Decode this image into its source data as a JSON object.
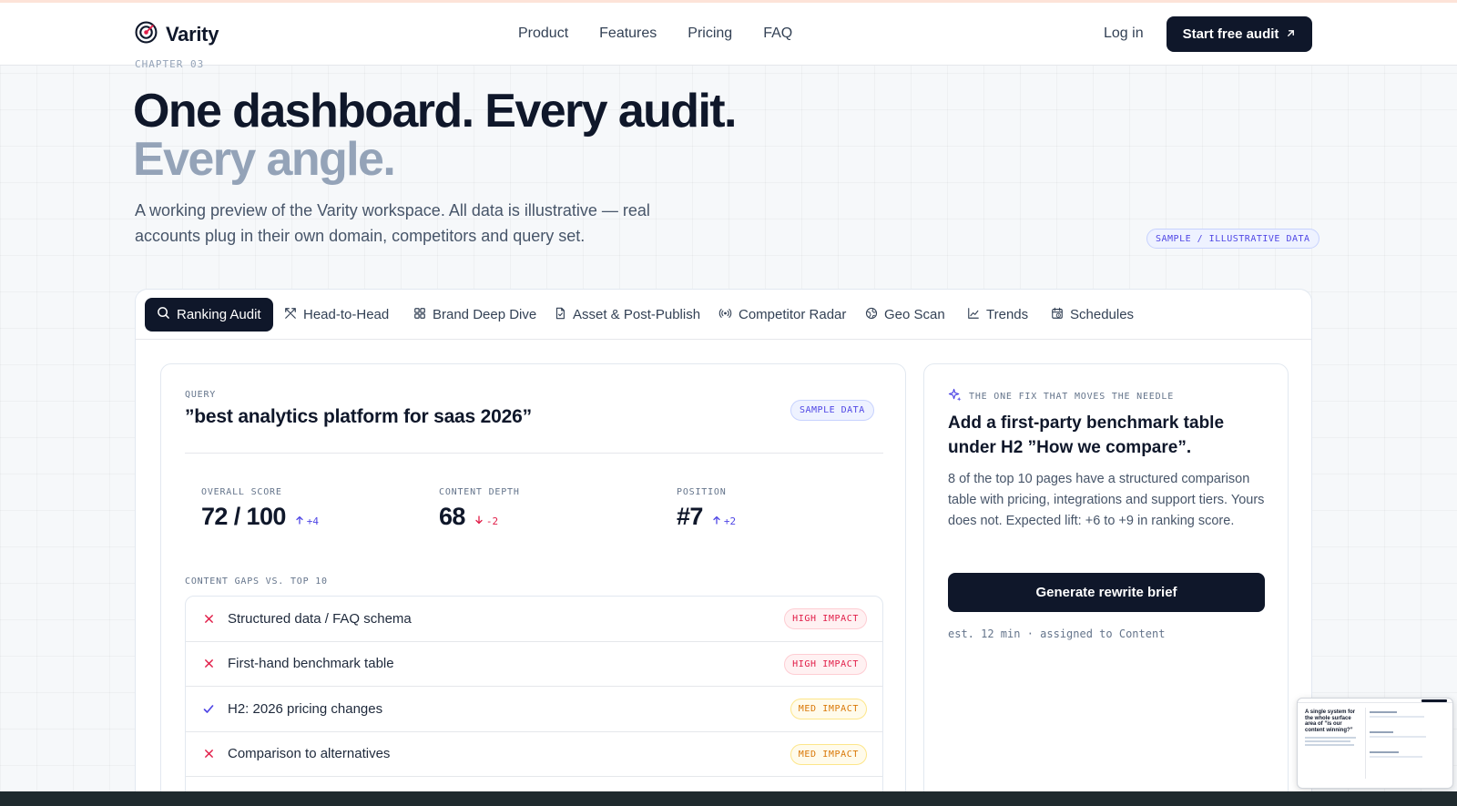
{
  "header": {
    "logo_text": "Varity",
    "nav": [
      "Product",
      "Features",
      "Pricing",
      "FAQ"
    ],
    "login": "Log in",
    "cta_label": "Start free audit",
    "cta_icon": "arrow-up-right-icon"
  },
  "hero": {
    "chapter": "CHAPTER 03",
    "title_line1": "One dashboard. Every audit.",
    "title_line2": "Every angle.",
    "lede": "A working preview of the Varity workspace. All data is illustrative — real accounts plug in their own domain, competitors and query set.",
    "sample_pill": "SAMPLE / ILLUSTRATIVE DATA"
  },
  "tabs": [
    {
      "label": "Ranking Audit",
      "icon": "search-icon",
      "active": true
    },
    {
      "label": "Head-to-Head",
      "icon": "swords-icon",
      "active": false
    },
    {
      "label": "Brand Deep Dive",
      "icon": "grid-icon",
      "active": false
    },
    {
      "label": "Asset & Post-Publish",
      "icon": "file-icon",
      "active": false
    },
    {
      "label": "Competitor Radar",
      "icon": "radio-icon",
      "active": false
    },
    {
      "label": "Geo Scan",
      "icon": "globe-icon",
      "active": false
    },
    {
      "label": "Trends",
      "icon": "chart-line-icon",
      "active": false
    },
    {
      "label": "Schedules",
      "icon": "calendar-clock-icon",
      "active": false
    }
  ],
  "audit": {
    "query_label": "QUERY",
    "query": "”best analytics platform for saas 2026”",
    "sample_tag": "SAMPLE DATA",
    "metrics": [
      {
        "label": "OVERALL SCORE",
        "value": "72 / 100",
        "delta": "+4",
        "direction": "up"
      },
      {
        "label": "CONTENT DEPTH",
        "value": "68",
        "delta": "-2",
        "direction": "down"
      },
      {
        "label": "POSITION",
        "value": "#7",
        "delta": "+2",
        "direction": "up"
      }
    ],
    "gaps_label": "CONTENT GAPS VS. TOP 10",
    "gaps": [
      {
        "text": "Structured data / FAQ schema",
        "status": "missing",
        "impact": "HIGH IMPACT",
        "level": "high"
      },
      {
        "text": "First-hand benchmark table",
        "status": "missing",
        "impact": "HIGH IMPACT",
        "level": "high"
      },
      {
        "text": "H2: 2026 pricing changes",
        "status": "present",
        "impact": "MED IMPACT",
        "level": "med"
      },
      {
        "text": "Comparison to alternatives",
        "status": "missing",
        "impact": "MED IMPACT",
        "level": "med"
      }
    ]
  },
  "fix": {
    "label": "THE ONE FIX THAT MOVES THE NEEDLE",
    "icon": "sparkles-icon",
    "title": "Add a first-party benchmark table under H2 ”How we compare”.",
    "body": "8 of the top 10 pages have a structured comparison table with pricing, integrations and support tiers. Yours does not. Expected lift: +6 to +9 in ranking score.",
    "button": "Generate rewrite brief",
    "meta": "est. 12 min · assigned to Content"
  },
  "thumbnail": {
    "headline": "A single system for the whole surface area of ”is our content winning?”"
  },
  "colors": {
    "ink": "#0f172a",
    "muted": "#94a3b8",
    "accent": "#4f46e5",
    "danger": "#e11d48",
    "warning": "#d97706"
  }
}
